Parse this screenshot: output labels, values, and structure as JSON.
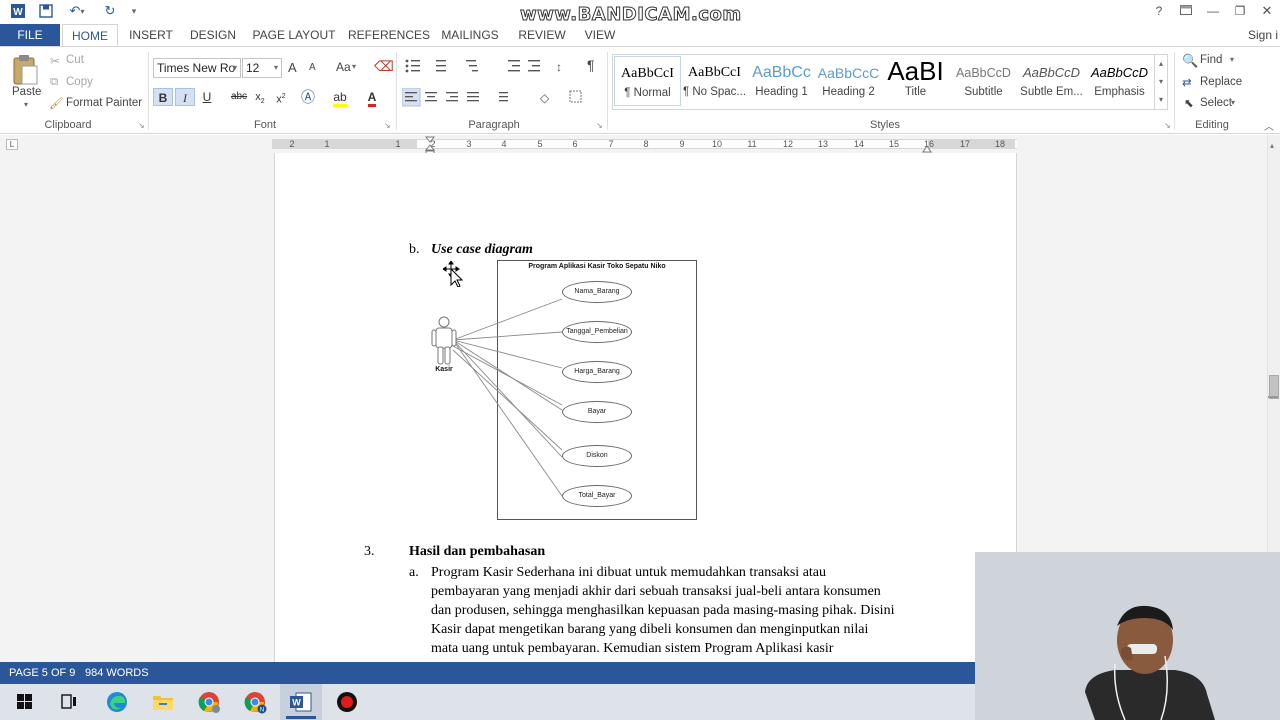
{
  "window": {
    "watermark": "www.BANDICAM.com",
    "help": "?",
    "sign_in": "Sign i"
  },
  "ribbon_tabs": {
    "file": "FILE",
    "items": [
      "HOME",
      "INSERT",
      "DESIGN",
      "PAGE LAYOUT",
      "REFERENCES",
      "MAILINGS",
      "REVIEW",
      "VIEW"
    ]
  },
  "clipboard": {
    "paste": "Paste",
    "cut": "Cut",
    "copy": "Copy",
    "format_painter": "Format Painter",
    "label": "Clipboard"
  },
  "font": {
    "name": "Times New Ro",
    "size": "12",
    "grow": "A",
    "shrink": "A",
    "case": "Aa",
    "bold": "B",
    "italic": "I",
    "underline": "U",
    "strike": "abc",
    "subscript": "x",
    "superscript": "x",
    "label": "Font"
  },
  "paragraph": {
    "label": "Paragraph",
    "pilcrow": "¶"
  },
  "styles": {
    "items": [
      {
        "preview": "AaBbCcI",
        "name": "¶ Normal"
      },
      {
        "preview": "AaBbCcI",
        "name": "¶ No Spac..."
      },
      {
        "preview": "AaBbCc",
        "name": "Heading 1"
      },
      {
        "preview": "AaBbCcC",
        "name": "Heading 2"
      },
      {
        "preview": "AaBI",
        "name": "Title"
      },
      {
        "preview": "AaBbCcD",
        "name": "Subtitle"
      },
      {
        "preview": "AaBbCcD",
        "name": "Subtle Em..."
      },
      {
        "preview": "AaBbCcD",
        "name": "Emphasis"
      }
    ],
    "label": "Styles"
  },
  "editing": {
    "find": "Find",
    "replace": "Replace",
    "select": "Select",
    "label": "Editing"
  },
  "ruler": {
    "numbers": [
      "2",
      "1",
      "1",
      "2",
      "3",
      "4",
      "5",
      "6",
      "7",
      "8",
      "9",
      "10",
      "11",
      "12",
      "13",
      "14",
      "15",
      "16",
      "17",
      "18"
    ]
  },
  "document": {
    "item_b_marker": "b.",
    "item_b_title": "Use case diagram",
    "diagram": {
      "system_title": "Program Aplikasi Kasir Toko Sepatu Niko",
      "actor": "Kasir",
      "use_cases": [
        "Nama_Barang",
        "Tanggal_Pembelian",
        "Harga_Barang",
        "Bayar",
        "Diskon",
        "Total_Bayar"
      ]
    },
    "section_number": "3.",
    "section_title": "Hasil dan pembahasan",
    "item_a_marker": "a.",
    "paragraph_lines": [
      "Program Kasir Sederhana ini dibuat untuk memudahkan transaksi atau",
      "pembayaran yang menjadi akhir dari sebuah transaksi jual-beli antara konsumen",
      "dan produsen, sehingga menghasilkan kepuasan pada masing-masing pihak. Disini",
      "Kasir dapat mengetikan barang yang dibeli konsumen dan menginputkan nilai",
      "mata uang untuk pembayaran. Kemudian sistem Program Aplikasi kasir"
    ]
  },
  "status": {
    "page": "PAGE 5 OF 9",
    "words": "984 WORDS"
  },
  "colors": {
    "accent": "#2b579a",
    "taskbar": "#dee3ea"
  }
}
